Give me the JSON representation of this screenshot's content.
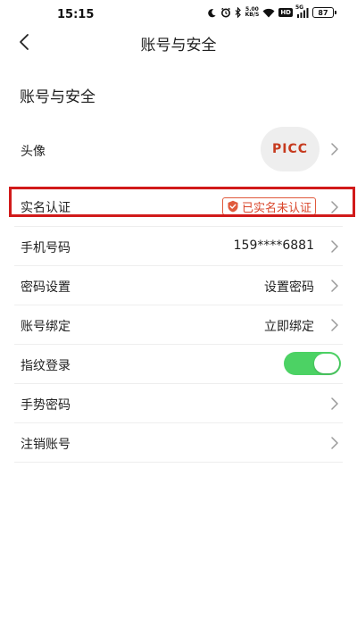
{
  "status_bar": {
    "time": "15:15",
    "net_speed_value": "5.00",
    "net_speed_unit": "KB/S",
    "hd_label": "HD",
    "signal_label": "5G",
    "battery": "87"
  },
  "nav": {
    "title": "账号与安全"
  },
  "section": {
    "title": "账号与安全"
  },
  "rows": {
    "avatar": {
      "label": "头像",
      "avatar_text": "PICC"
    },
    "realname": {
      "label": "实名认证",
      "badge": "已实名未认证"
    },
    "phone": {
      "label": "手机号码",
      "value": "159****6881"
    },
    "password": {
      "label": "密码设置",
      "value": "设置密码"
    },
    "binding": {
      "label": "账号绑定",
      "value": "立即绑定"
    },
    "fingerprint": {
      "label": "指纹登录",
      "enabled": true
    },
    "gesture": {
      "label": "手势密码"
    },
    "cancel": {
      "label": "注销账号"
    }
  },
  "colors": {
    "accent_red": "#d11a1a",
    "badge_red": "#d9452a",
    "toggle_green": "#4cd264",
    "logo_red": "#c63a1e"
  }
}
